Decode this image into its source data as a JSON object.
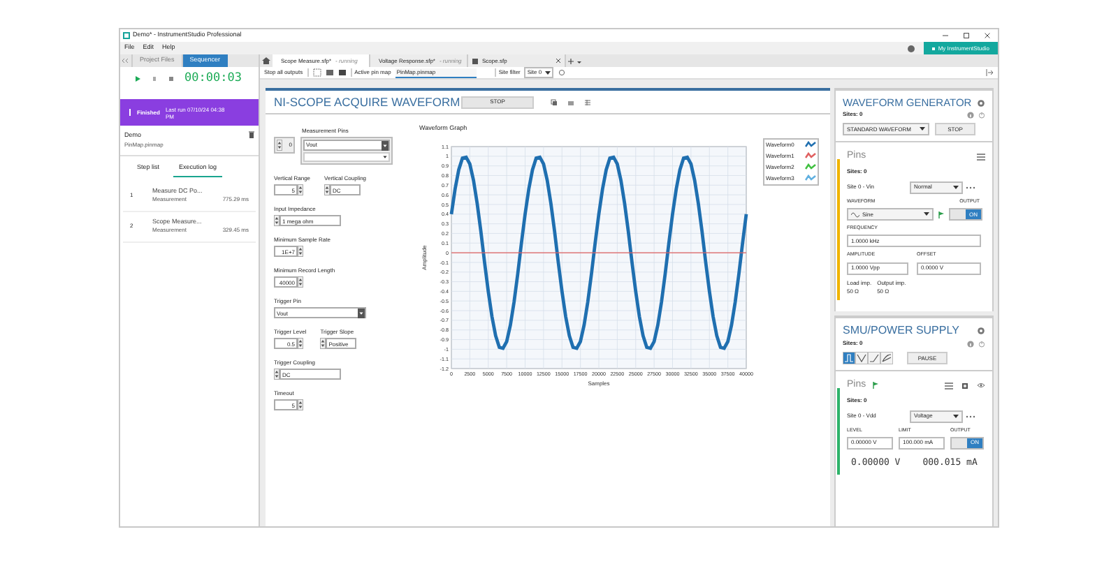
{
  "window": {
    "title": "Demo* - InstrumentStudio Professional"
  },
  "menu": [
    "File",
    "Edit",
    "Help"
  ],
  "account_button": "My InstrumentStudio",
  "left_panel": {
    "tabs": [
      {
        "label": "Project Files",
        "selected": false
      },
      {
        "label": "Sequencer",
        "selected": true
      }
    ],
    "timer": "00:00:03",
    "run_status": {
      "status": "Finished",
      "detail": "Last run 07/10/24 04:38 PM"
    },
    "sequence": {
      "name": "Demo",
      "pinmap": "PinMap.pinmap"
    },
    "log_tabs": [
      {
        "label": "Step list",
        "selected": false
      },
      {
        "label": "Execution log",
        "selected": true
      }
    ],
    "steps": [
      {
        "index": "1",
        "name": "Measure DC Po...",
        "type": "Measurement",
        "duration": "775.29 ms"
      },
      {
        "index": "2",
        "name": "Scope Measure...",
        "type": "Measurement",
        "duration": "329.45 ms"
      }
    ]
  },
  "document_tabs": [
    {
      "label": "Scope Measure.sfp*",
      "status": "- running",
      "selected": true
    },
    {
      "label": "Voltage Response.sfp*",
      "status": "- running",
      "selected": false
    },
    {
      "label": "Scope.sfp",
      "selected": false
    }
  ],
  "toolbar": {
    "stop_all": "Stop all outputs",
    "pin_map_label": "Active pin map",
    "pin_map": "PinMap.pinmap",
    "site_filter_label": "Site filter",
    "site_filter": "Site 0"
  },
  "scope": {
    "title": "NI-SCOPE ACQUIRE WAVEFORM",
    "stop": "STOP",
    "pins_label": "Measurement Pins",
    "pin_index": "0",
    "pin": "Vout",
    "form": [
      [
        {
          "label": "Vertical Range",
          "value": "5",
          "kind": "numeric"
        },
        {
          "label": "Vertical Coupling",
          "value": "DC",
          "kind": "ring"
        }
      ],
      [
        {
          "label": "Input Impedance",
          "value": "1 mega ohm",
          "kind": "ring"
        }
      ],
      [
        {
          "label": "Minimum Sample Rate",
          "value": "1E+7",
          "kind": "numeric"
        }
      ],
      [
        {
          "label": "Minimum Record Length",
          "value": "40000",
          "kind": "numeric"
        }
      ],
      [
        {
          "label": "Trigger Pin",
          "value": "Vout",
          "kind": "dropdown"
        }
      ],
      [
        {
          "label": "Trigger Level",
          "value": "0.5",
          "kind": "numeric"
        },
        {
          "label": "Trigger Slope",
          "value": "Positive",
          "kind": "ring"
        }
      ],
      [
        {
          "label": "Trigger Coupling",
          "value": "DC",
          "kind": "ring"
        }
      ],
      [
        {
          "label": "Timeout",
          "value": "5",
          "kind": "numeric"
        }
      ]
    ],
    "graph": {
      "title": "Waveform Graph",
      "chart_data": {
        "type": "line",
        "grid": true,
        "xlabel": "Samples",
        "ylabel": "Amplitude",
        "xlim": [
          0,
          40000
        ],
        "ylim": [
          -1.2,
          1.1
        ],
        "xticks": [
          0,
          2500,
          5000,
          7500,
          10000,
          12500,
          15000,
          17500,
          20000,
          22500,
          25000,
          27500,
          30000,
          32500,
          35000,
          37500,
          40000
        ],
        "yticks": [
          1.1,
          1,
          0.9,
          0.8,
          0.7,
          0.6,
          0.5,
          0.4,
          0.3,
          0.2,
          0.1,
          0,
          -0.1,
          -0.2,
          -0.3,
          -0.4,
          -0.5,
          -0.6,
          -0.7,
          -0.8,
          -0.9,
          -1,
          -1.1,
          -1.2
        ],
        "x": [
          0,
          500,
          1000,
          1500,
          2000,
          2500,
          3000,
          3500,
          4000,
          4500,
          5000,
          5500,
          6000,
          6500,
          7000,
          7500,
          8000,
          8500,
          9000,
          9500,
          10000,
          10500,
          11000,
          11500,
          12000,
          12500,
          13000,
          13500,
          14000,
          14500,
          15000,
          15500,
          16000,
          16500,
          17000,
          17500,
          18000,
          18500,
          19000,
          19500,
          20000,
          20500,
          21000,
          21500,
          22000,
          22500,
          23000,
          23500,
          24000,
          24500,
          25000,
          25500,
          26000,
          26500,
          27000,
          27500,
          28000,
          28500,
          29000,
          29500,
          30000,
          30500,
          31000,
          31500,
          32000,
          32500,
          33000,
          33500,
          34000,
          34500,
          35000,
          35500,
          36000,
          36500,
          37000,
          37500,
          38000,
          38500,
          39000,
          39500,
          40000
        ],
        "series": [
          {
            "name": "Waveform0",
            "color": "#1f6fb0",
            "values": [
              0.4,
              0.66,
              0.86,
              0.98,
              0.99,
              0.92,
              0.75,
              0.51,
              0.22,
              -0.1,
              -0.4,
              -0.66,
              -0.86,
              -0.98,
              -0.99,
              -0.92,
              -0.75,
              -0.51,
              -0.22,
              0.1,
              0.4,
              0.66,
              0.86,
              0.98,
              0.99,
              0.92,
              0.75,
              0.51,
              0.22,
              -0.1,
              -0.4,
              -0.66,
              -0.86,
              -0.98,
              -0.99,
              -0.92,
              -0.75,
              -0.51,
              -0.22,
              0.1,
              0.4,
              0.66,
              0.86,
              0.98,
              0.99,
              0.92,
              0.75,
              0.51,
              0.22,
              -0.1,
              -0.4,
              -0.66,
              -0.86,
              -0.98,
              -0.99,
              -0.92,
              -0.75,
              -0.51,
              -0.22,
              0.1,
              0.4,
              0.66,
              0.86,
              0.98,
              0.99,
              0.92,
              0.75,
              0.51,
              0.22,
              -0.1,
              -0.4,
              -0.66,
              -0.86,
              -0.98,
              -0.99,
              -0.92,
              -0.75,
              -0.51,
              -0.22,
              0.1,
              0.4
            ]
          },
          {
            "name": "Waveform1",
            "color": "#e06060",
            "values": [
              0,
              0,
              0,
              0,
              0,
              0,
              0,
              0,
              0,
              0,
              0,
              0,
              0,
              0,
              0,
              0,
              0,
              0,
              0,
              0,
              0,
              0,
              0,
              0,
              0,
              0,
              0,
              0,
              0,
              0,
              0,
              0,
              0,
              0,
              0,
              0,
              0,
              0,
              0,
              0,
              0,
              0,
              0,
              0,
              0,
              0,
              0,
              0,
              0,
              0,
              0,
              0,
              0,
              0,
              0,
              0,
              0,
              0,
              0,
              0,
              0,
              0,
              0,
              0,
              0,
              0,
              0,
              0,
              0,
              0,
              0,
              0,
              0,
              0,
              0,
              0,
              0,
              0,
              0,
              0,
              0
            ]
          },
          {
            "name": "Waveform2",
            "color": "#40c040",
            "values": [
              null,
              null,
              null,
              null,
              null,
              null,
              null,
              null,
              null,
              null,
              null,
              null,
              null,
              null,
              null,
              null,
              null,
              null,
              null,
              null,
              null,
              null,
              null,
              null,
              null,
              null,
              null,
              null,
              null,
              null,
              null,
              null,
              null,
              null,
              null,
              null,
              null,
              null,
              null,
              null,
              null,
              null,
              null,
              null,
              null,
              null,
              null,
              null,
              null,
              null,
              null,
              null,
              null,
              null,
              null,
              null,
              null,
              null,
              null,
              null,
              null,
              null,
              null,
              null,
              null,
              null,
              null,
              null,
              null,
              null,
              null,
              null,
              null,
              null,
              null,
              null,
              null,
              null,
              null,
              null,
              null
            ]
          },
          {
            "name": "Waveform3",
            "color": "#60b0e0",
            "values": [
              null,
              null,
              null,
              null,
              null,
              null,
              null,
              null,
              null,
              null,
              null,
              null,
              null,
              null,
              null,
              null,
              null,
              null,
              null,
              null,
              null,
              null,
              null,
              null,
              null,
              null,
              null,
              null,
              null,
              null,
              null,
              null,
              null,
              null,
              null,
              null,
              null,
              null,
              null,
              null,
              null,
              null,
              null,
              null,
              null,
              null,
              null,
              null,
              null,
              null,
              null,
              null,
              null,
              null,
              null,
              null,
              null,
              null,
              null,
              null,
              null,
              null,
              null,
              null,
              null,
              null,
              null,
              null,
              null,
              null,
              null,
              null,
              null,
              null,
              null,
              null,
              null,
              null,
              null,
              null,
              null
            ]
          }
        ]
      }
    }
  },
  "waveform_generator": {
    "title": "WAVEFORM GENERATOR",
    "sites": "Sites: 0",
    "mode": "STANDARD WAVEFORM",
    "stop": "STOP",
    "pins_title": "Pins",
    "pins_sites": "Sites: 0",
    "channel": "Site 0 - Vin",
    "channel_mode": "Normal",
    "waveform_label": "WAVEFORM",
    "waveform": "Sine",
    "output_label": "OUTPUT",
    "output": "ON",
    "output_on": true,
    "frequency_label": "FREQUENCY",
    "frequency": "1.0000 kHz",
    "amplitude_label": "AMPLITUDE",
    "amplitude": "1.0000 Vpp",
    "offset_label": "OFFSET",
    "offset": "0.0000 V",
    "load_label": "Load imp.",
    "load": "50 Ω",
    "output_imp_label": "Output imp.",
    "output_imp": "50 Ω"
  },
  "smu": {
    "title": "SMU/POWER SUPPLY",
    "sites": "Sites: 0",
    "modes": [
      {
        "selected": true
      },
      {
        "selected": false
      },
      {
        "selected": false
      },
      {
        "selected": false
      }
    ],
    "pause": "PAUSE",
    "pins_title": "Pins",
    "pins_sites": "Sites: 0",
    "channel": "Site 0 - Vdd",
    "channel_mode": "Voltage",
    "level_label": "LEVEL",
    "level_value": "0.00000 V",
    "limit_label": "LIMIT",
    "limit": "100.000 mA",
    "output_label": "OUTPUT",
    "output": "ON",
    "output_on": true,
    "voltage_reading": "0.00000 V",
    "current_reading": "000.015 mA"
  }
}
